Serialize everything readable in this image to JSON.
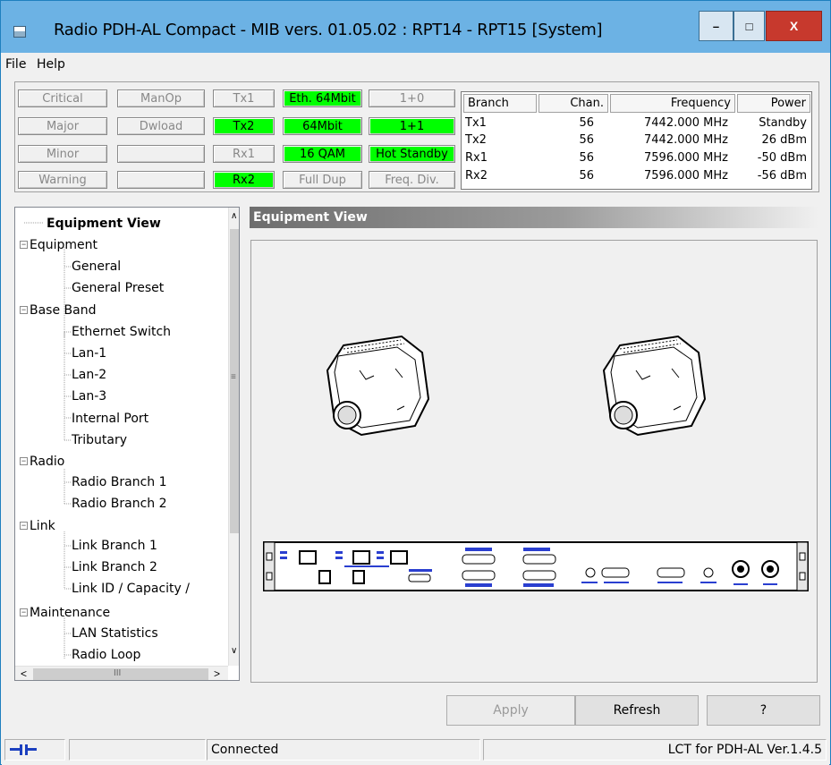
{
  "title": "Radio PDH-AL Compact - MIB vers. 01.05.02 : RPT14 - RPT15 [System]",
  "window_controls": {
    "minimize": "–",
    "maximize": "□",
    "close": "X"
  },
  "menu": [
    "File",
    "Help"
  ],
  "alarms": {
    "critical": "Critical",
    "manop": "ManOp",
    "major": "Major",
    "dwload": "Dwload",
    "minor": "Minor",
    "warning": "Warning"
  },
  "indicators": {
    "tx1": "Tx1",
    "tx2": "Tx2",
    "rx1": "Rx1",
    "rx2": "Rx2",
    "eth": "Eth. 64Mbit",
    "rate": "64Mbit",
    "mod": "16 QAM",
    "duplex": "Full Dup",
    "c10": "1+0",
    "c11": "1+1",
    "hot": "Hot Standby",
    "freqdiv": "Freq. Div."
  },
  "branch_table": {
    "headers": [
      "Branch",
      "Chan.",
      "Frequency",
      "Power"
    ],
    "rows": [
      [
        "Tx1",
        "56",
        "7442.000 MHz",
        "Standby"
      ],
      [
        "Tx2",
        "56",
        "7442.000 MHz",
        "26 dBm"
      ],
      [
        "Rx1",
        "56",
        "7596.000 MHz",
        "-50 dBm"
      ],
      [
        "Rx2",
        "56",
        "7596.000 MHz",
        "-56 dBm"
      ]
    ]
  },
  "tree": {
    "root": "Equipment View",
    "nodes": [
      "Equipment",
      "General",
      "General Preset",
      "Base Band",
      "Ethernet Switch",
      "Lan-1",
      "Lan-2",
      "Lan-3",
      "Internal Port",
      "Tributary",
      "Radio",
      "Radio Branch 1",
      "Radio Branch 2",
      "Link",
      "Link Branch 1",
      "Link Branch 2",
      "Link ID / Capacity /",
      "Maintenance",
      "LAN Statistics",
      "Radio Loop"
    ],
    "scroll_up": "∧",
    "scroll_down": "∨",
    "scroll_left": "<",
    "scroll_right": ">",
    "grip": "≡",
    "hgrip": "III"
  },
  "content": {
    "header": "Equipment View"
  },
  "buttons": {
    "apply": "Apply",
    "refresh": "Refresh",
    "help": "?"
  },
  "statusbar": {
    "connection": "Connected",
    "version": "LCT for PDH-AL Ver.1.4.5"
  }
}
